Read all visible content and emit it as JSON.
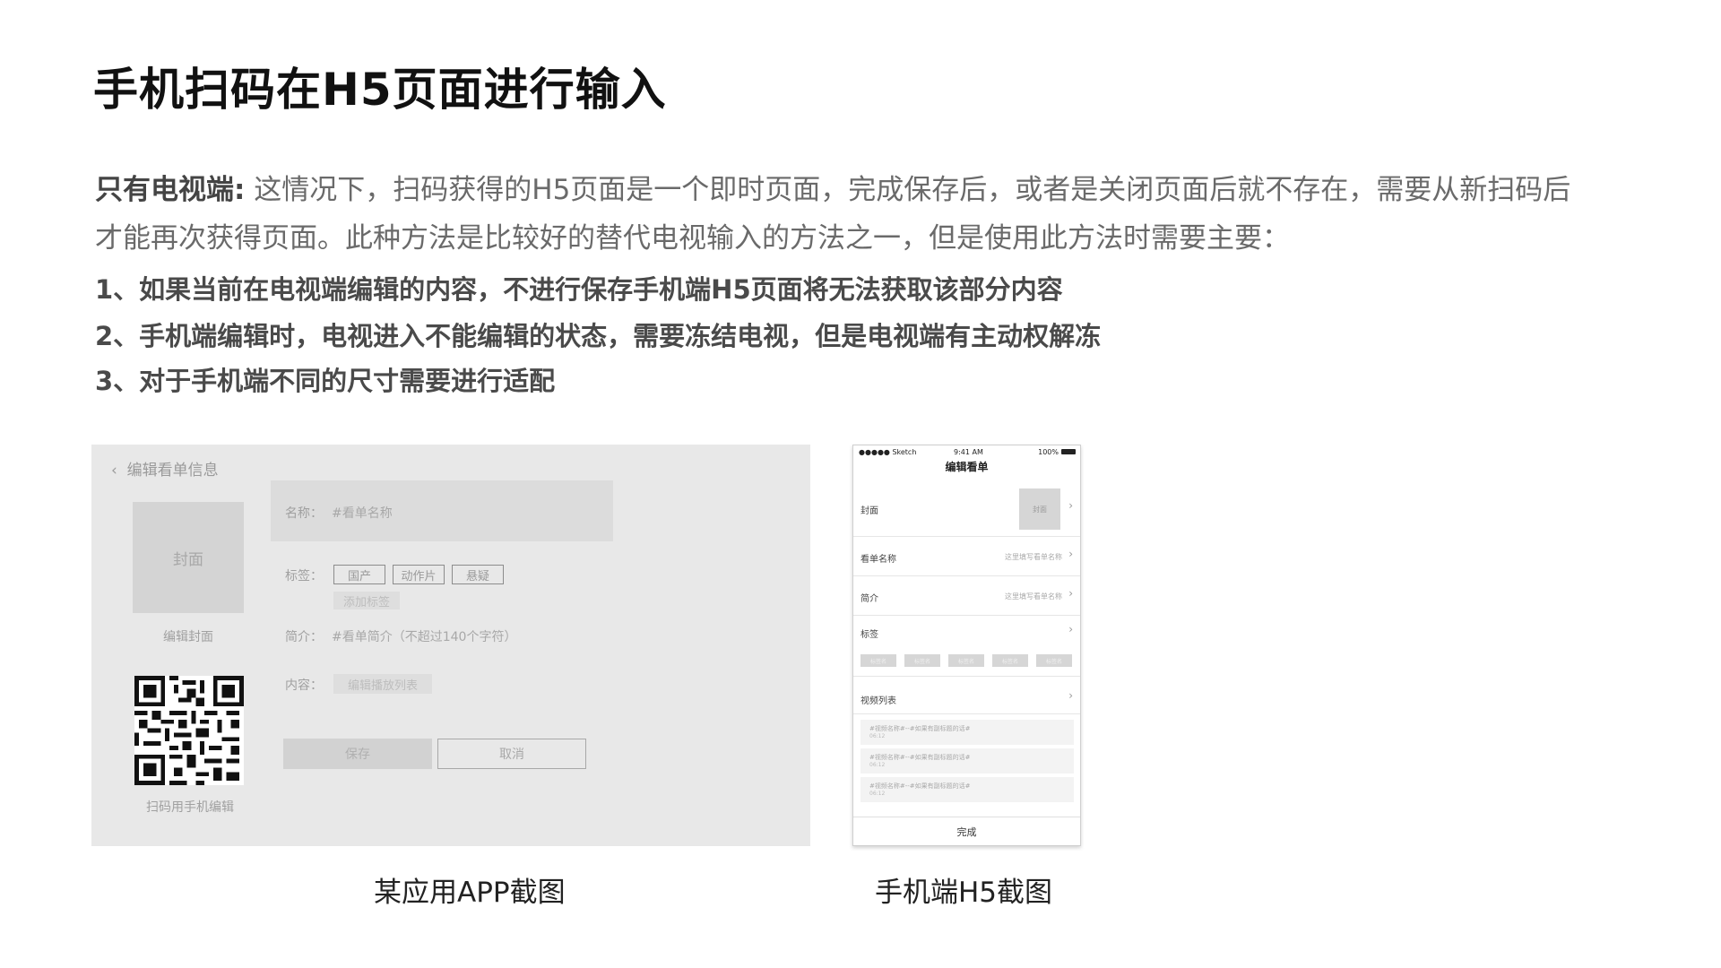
{
  "title": "手机扫码在H5页面进行输入",
  "intro": {
    "bold": "只有电视端:",
    "line1": " 这情况下，扫码获得的H5页面是一个即时页面，完成保存后，或者是关闭页面后就不存在，需要从新扫码后",
    "line2": "才能再次获得页面。此种方法是比较好的替代电视输入的方法之一，但是使用此方法时需要主要："
  },
  "points": [
    "1、如果当前在电视端编辑的内容，不进行保存手机端H5页面将无法获取该部分内容",
    "2、手机端编辑时，电视进入不能编辑的状态，需要冻结电视，但是电视端有主动权解冻",
    "3、对于手机端不同的尺寸需要进行适配"
  ],
  "app_shot": {
    "back_icon": "chevron-left-icon",
    "header": "编辑看单信息",
    "cover": "封面",
    "edit_cover": "编辑封面",
    "qr_label": "扫码用手机编辑",
    "name_label": "名称：",
    "name_value": "#看单名称",
    "tags_label": "标签：",
    "tags": [
      "国产",
      "动作片",
      "悬疑"
    ],
    "add_tag": "添加标签",
    "intro_label": "简介：",
    "intro_value": "#看单简介（不超过140个字符）",
    "content_label": "内容：",
    "content_button": "编辑播放列表",
    "save": "保存",
    "cancel": "取消"
  },
  "phone_shot": {
    "status_carrier": "●●●●● Sketch",
    "status_time": "9:41 AM",
    "status_battery": "100%",
    "title": "编辑看单",
    "cover_label": "封面",
    "cover_thumb": "封面",
    "name_label": "看单名称",
    "name_placeholder": "这里填写看单名称",
    "intro_label": "简介",
    "intro_placeholder": "这里填写看单名称",
    "tags_label": "标签",
    "tag_chips": [
      "标签名",
      "标签名",
      "标签名",
      "标签名",
      "标签名"
    ],
    "video_list_label": "视频列表",
    "videos": [
      {
        "title": "#视频名称#--#如果有副标题的话#",
        "duration": "06:12"
      },
      {
        "title": "#视频名称#--#如果有副标题的话#",
        "duration": "06:12"
      },
      {
        "title": "#视频名称#--#如果有副标题的话#",
        "duration": "06:12"
      }
    ],
    "done": "完成"
  },
  "captions": {
    "left": "某应用APP截图",
    "right": "手机端H5截图"
  }
}
